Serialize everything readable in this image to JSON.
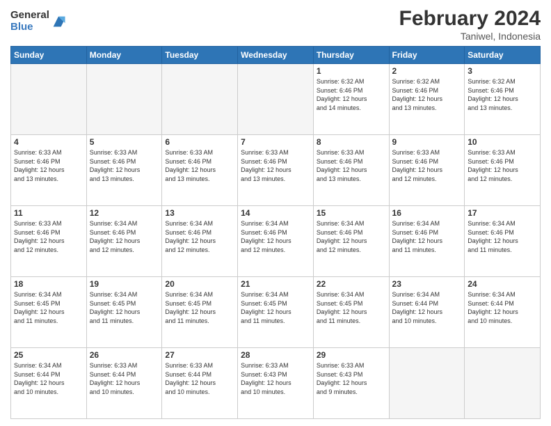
{
  "logo": {
    "line1": "General",
    "line2": "Blue"
  },
  "title": "February 2024",
  "subtitle": "Taniwel, Indonesia",
  "days_header": [
    "Sunday",
    "Monday",
    "Tuesday",
    "Wednesday",
    "Thursday",
    "Friday",
    "Saturday"
  ],
  "weeks": [
    [
      {
        "day": "",
        "info": ""
      },
      {
        "day": "",
        "info": ""
      },
      {
        "day": "",
        "info": ""
      },
      {
        "day": "",
        "info": ""
      },
      {
        "day": "1",
        "info": "Sunrise: 6:32 AM\nSunset: 6:46 PM\nDaylight: 12 hours\nand 14 minutes."
      },
      {
        "day": "2",
        "info": "Sunrise: 6:32 AM\nSunset: 6:46 PM\nDaylight: 12 hours\nand 13 minutes."
      },
      {
        "day": "3",
        "info": "Sunrise: 6:32 AM\nSunset: 6:46 PM\nDaylight: 12 hours\nand 13 minutes."
      }
    ],
    [
      {
        "day": "4",
        "info": "Sunrise: 6:33 AM\nSunset: 6:46 PM\nDaylight: 12 hours\nand 13 minutes."
      },
      {
        "day": "5",
        "info": "Sunrise: 6:33 AM\nSunset: 6:46 PM\nDaylight: 12 hours\nand 13 minutes."
      },
      {
        "day": "6",
        "info": "Sunrise: 6:33 AM\nSunset: 6:46 PM\nDaylight: 12 hours\nand 13 minutes."
      },
      {
        "day": "7",
        "info": "Sunrise: 6:33 AM\nSunset: 6:46 PM\nDaylight: 12 hours\nand 13 minutes."
      },
      {
        "day": "8",
        "info": "Sunrise: 6:33 AM\nSunset: 6:46 PM\nDaylight: 12 hours\nand 13 minutes."
      },
      {
        "day": "9",
        "info": "Sunrise: 6:33 AM\nSunset: 6:46 PM\nDaylight: 12 hours\nand 12 minutes."
      },
      {
        "day": "10",
        "info": "Sunrise: 6:33 AM\nSunset: 6:46 PM\nDaylight: 12 hours\nand 12 minutes."
      }
    ],
    [
      {
        "day": "11",
        "info": "Sunrise: 6:33 AM\nSunset: 6:46 PM\nDaylight: 12 hours\nand 12 minutes."
      },
      {
        "day": "12",
        "info": "Sunrise: 6:34 AM\nSunset: 6:46 PM\nDaylight: 12 hours\nand 12 minutes."
      },
      {
        "day": "13",
        "info": "Sunrise: 6:34 AM\nSunset: 6:46 PM\nDaylight: 12 hours\nand 12 minutes."
      },
      {
        "day": "14",
        "info": "Sunrise: 6:34 AM\nSunset: 6:46 PM\nDaylight: 12 hours\nand 12 minutes."
      },
      {
        "day": "15",
        "info": "Sunrise: 6:34 AM\nSunset: 6:46 PM\nDaylight: 12 hours\nand 12 minutes."
      },
      {
        "day": "16",
        "info": "Sunrise: 6:34 AM\nSunset: 6:46 PM\nDaylight: 12 hours\nand 11 minutes."
      },
      {
        "day": "17",
        "info": "Sunrise: 6:34 AM\nSunset: 6:46 PM\nDaylight: 12 hours\nand 11 minutes."
      }
    ],
    [
      {
        "day": "18",
        "info": "Sunrise: 6:34 AM\nSunset: 6:45 PM\nDaylight: 12 hours\nand 11 minutes."
      },
      {
        "day": "19",
        "info": "Sunrise: 6:34 AM\nSunset: 6:45 PM\nDaylight: 12 hours\nand 11 minutes."
      },
      {
        "day": "20",
        "info": "Sunrise: 6:34 AM\nSunset: 6:45 PM\nDaylight: 12 hours\nand 11 minutes."
      },
      {
        "day": "21",
        "info": "Sunrise: 6:34 AM\nSunset: 6:45 PM\nDaylight: 12 hours\nand 11 minutes."
      },
      {
        "day": "22",
        "info": "Sunrise: 6:34 AM\nSunset: 6:45 PM\nDaylight: 12 hours\nand 11 minutes."
      },
      {
        "day": "23",
        "info": "Sunrise: 6:34 AM\nSunset: 6:44 PM\nDaylight: 12 hours\nand 10 minutes."
      },
      {
        "day": "24",
        "info": "Sunrise: 6:34 AM\nSunset: 6:44 PM\nDaylight: 12 hours\nand 10 minutes."
      }
    ],
    [
      {
        "day": "25",
        "info": "Sunrise: 6:34 AM\nSunset: 6:44 PM\nDaylight: 12 hours\nand 10 minutes."
      },
      {
        "day": "26",
        "info": "Sunrise: 6:33 AM\nSunset: 6:44 PM\nDaylight: 12 hours\nand 10 minutes."
      },
      {
        "day": "27",
        "info": "Sunrise: 6:33 AM\nSunset: 6:44 PM\nDaylight: 12 hours\nand 10 minutes."
      },
      {
        "day": "28",
        "info": "Sunrise: 6:33 AM\nSunset: 6:43 PM\nDaylight: 12 hours\nand 10 minutes."
      },
      {
        "day": "29",
        "info": "Sunrise: 6:33 AM\nSunset: 6:43 PM\nDaylight: 12 hours\nand 9 minutes."
      },
      {
        "day": "",
        "info": ""
      },
      {
        "day": "",
        "info": ""
      }
    ]
  ]
}
